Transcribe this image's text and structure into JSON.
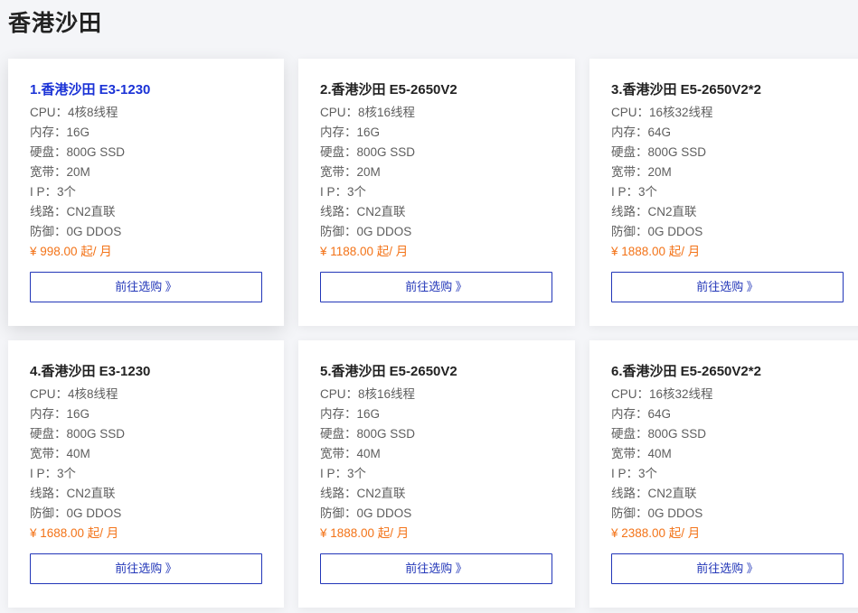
{
  "page": {
    "title": "香港沙田"
  },
  "labels": {
    "cpu": "CPU：",
    "memory": "内存：",
    "disk": "硬盘：",
    "bandwidth": "宽带：",
    "ip": "I P：",
    "line": "线路：",
    "defense": "防御："
  },
  "products": [
    {
      "title": "1.香港沙田 E3-1230",
      "cpu": "4核8线程",
      "memory": "16G",
      "disk": "800G SSD",
      "bandwidth": "20M",
      "ip": "3个",
      "line": "CN2直联",
      "defense": "0G DDOS",
      "price": "¥ 998.00 起/ 月",
      "button": "前往选购 》"
    },
    {
      "title": "2.香港沙田 E5-2650V2",
      "cpu": "8核16线程",
      "memory": "16G",
      "disk": "800G SSD",
      "bandwidth": "20M",
      "ip": "3个",
      "line": "CN2直联",
      "defense": "0G DDOS",
      "price": "¥ 1188.00 起/ 月",
      "button": "前往选购 》"
    },
    {
      "title": "3.香港沙田 E5-2650V2*2",
      "cpu": "16核32线程",
      "memory": "64G",
      "disk": "800G SSD",
      "bandwidth": "20M",
      "ip": "3个",
      "line": "CN2直联",
      "defense": "0G DDOS",
      "price": "¥ 1888.00 起/ 月",
      "button": "前往选购 》"
    },
    {
      "title": "4.香港沙田 E3-1230",
      "cpu": "4核8线程",
      "memory": "16G",
      "disk": "800G SSD",
      "bandwidth": "40M",
      "ip": "3个",
      "line": "CN2直联",
      "defense": "0G DDOS",
      "price": "¥ 1688.00 起/ 月",
      "button": "前往选购 》"
    },
    {
      "title": "5.香港沙田 E5-2650V2",
      "cpu": "8核16线程",
      "memory": "16G",
      "disk": "800G SSD",
      "bandwidth": "40M",
      "ip": "3个",
      "line": "CN2直联",
      "defense": "0G DDOS",
      "price": "¥ 1888.00 起/ 月",
      "button": "前往选购 》"
    },
    {
      "title": "6.香港沙田 E5-2650V2*2",
      "cpu": "16核32线程",
      "memory": "64G",
      "disk": "800G SSD",
      "bandwidth": "40M",
      "ip": "3个",
      "line": "CN2直联",
      "defense": "0G DDOS",
      "price": "¥ 2388.00 起/ 月",
      "button": "前往选购 》"
    }
  ],
  "colors": {
    "active_title": "#1a32d6",
    "price": "#f37318",
    "button_border": "#2236b8"
  }
}
